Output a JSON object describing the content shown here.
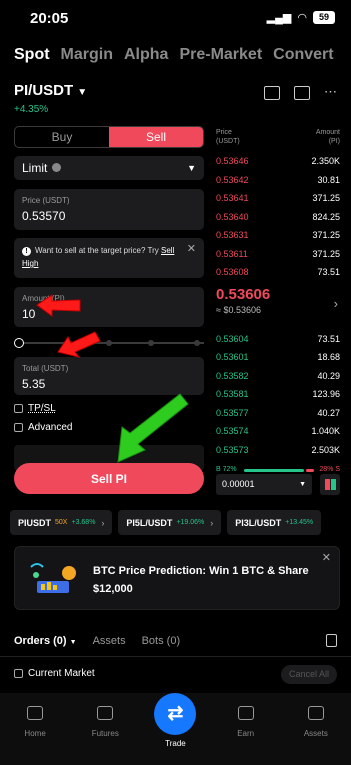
{
  "status_bar": {
    "time": "20:05",
    "battery": "59"
  },
  "top_tabs": [
    "Spot",
    "Margin",
    "Alpha",
    "Pre-Market",
    "Convert"
  ],
  "pair": {
    "name": "PI/USDT",
    "change": "+4.35%"
  },
  "order_form": {
    "buy_label": "Buy",
    "sell_label": "Sell",
    "order_type": "Limit",
    "price_label": "Price (USDT)",
    "price_value": "0.53570",
    "tip_text": "Want to sell at the target price? Try",
    "tip_link_1": "Sell",
    "tip_link_2": "High",
    "amount_label": "Amount (PI)",
    "amount_value": "10",
    "total_label": "Total (USDT)",
    "total_value": "5.35",
    "tpsl_label": "TP/SL",
    "advanced_label": "Advanced",
    "submit_label": "Sell PI"
  },
  "order_book": {
    "price_header": "Price",
    "price_unit": "(USDT)",
    "amount_header": "Amount",
    "amount_unit": "(PI)",
    "asks": [
      {
        "price": "0.53646",
        "amount": "2.350K"
      },
      {
        "price": "0.53642",
        "amount": "30.81"
      },
      {
        "price": "0.53641",
        "amount": "371.25"
      },
      {
        "price": "0.53640",
        "amount": "824.25"
      },
      {
        "price": "0.53631",
        "amount": "371.25"
      },
      {
        "price": "0.53611",
        "amount": "371.25"
      },
      {
        "price": "0.53608",
        "amount": "73.51"
      }
    ],
    "last_price": "0.53606",
    "last_price_usd": "≈ $0.53606",
    "bids": [
      {
        "price": "0.53604",
        "amount": "73.51"
      },
      {
        "price": "0.53601",
        "amount": "18.68"
      },
      {
        "price": "0.53582",
        "amount": "40.29"
      },
      {
        "price": "0.53581",
        "amount": "123.96"
      },
      {
        "price": "0.53577",
        "amount": "40.27"
      },
      {
        "price": "0.53574",
        "amount": "1.040K"
      },
      {
        "price": "0.53573",
        "amount": "2.503K"
      }
    ],
    "buy_ratio": "B 72%",
    "sell_ratio": "28% S",
    "depth": "0.00001"
  },
  "tickers": [
    {
      "symbol": "PIUSDT",
      "leverage": "50X",
      "change": "+3.68%"
    },
    {
      "symbol": "PI5L/USDT",
      "change": "+19.06%"
    },
    {
      "symbol": "PI3L/USDT",
      "change": "+13.45%"
    }
  ],
  "promo": {
    "title": "BTC Price Prediction: Win 1 BTC & Share",
    "amount": "$12,000"
  },
  "orders": {
    "tab_orders": "Orders (0)",
    "tab_assets": "Assets",
    "tab_bots": "Bots (0)",
    "current_market": "Current Market",
    "cancel_all": "Cancel All"
  },
  "bottom_nav": [
    "Home",
    "Futures",
    "Trade",
    "Earn",
    "Assets"
  ],
  "colors": {
    "sell": "#f0495b",
    "buy": "#25c48a",
    "accent": "#1677ff",
    "annotation_red": "#ff1a1a",
    "annotation_green": "#2ecc1f"
  }
}
